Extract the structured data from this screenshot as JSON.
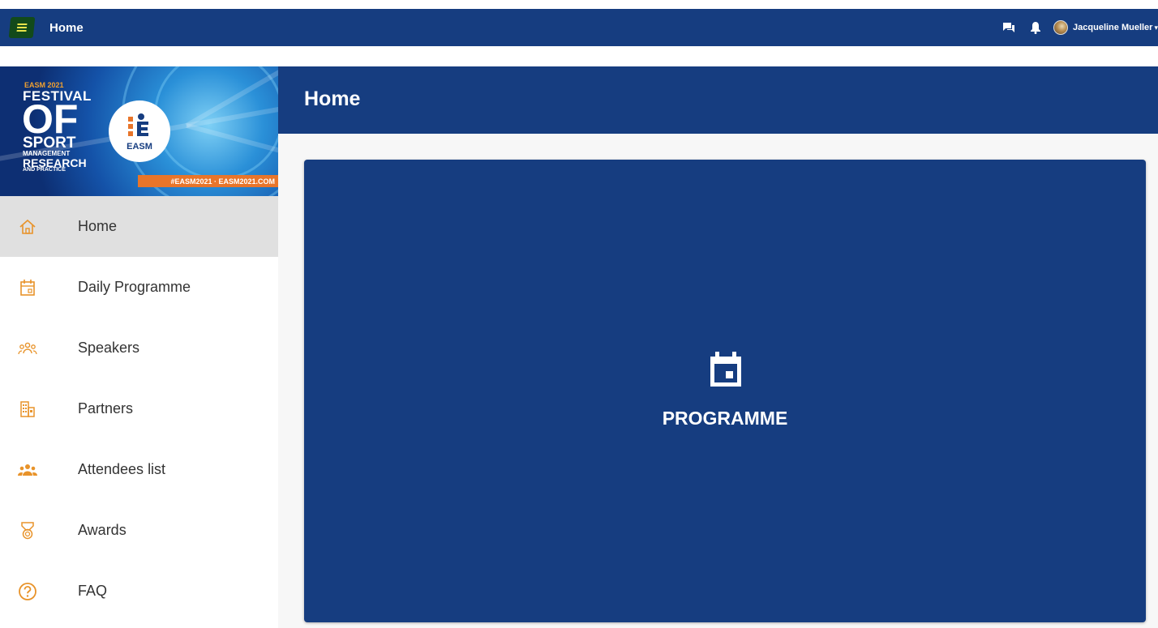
{
  "topbar": {
    "title": "Home",
    "user_name": "Jacqueline Mueller",
    "icons": [
      "menu-icon",
      "chat-icon",
      "bell-icon",
      "avatar",
      "chevron-down-icon"
    ]
  },
  "banner": {
    "line_small": "EASM 2021",
    "line_festival": "FESTIVAL",
    "line_of": "OF",
    "line_sport": "SPORT",
    "line_management": "MANAGEMENT",
    "line_research": "RESEARCH",
    "line_practice": "AND PRACTICE",
    "logo_text": "EASM",
    "strip_text": "#EASM2021 · EASM2021.COM"
  },
  "sidebar": {
    "items": [
      {
        "label": "Home",
        "icon": "home-icon",
        "active": true
      },
      {
        "label": "Daily Programme",
        "icon": "calendar-icon",
        "active": false
      },
      {
        "label": "Speakers",
        "icon": "speakers-icon",
        "active": false
      },
      {
        "label": "Partners",
        "icon": "building-icon",
        "active": false
      },
      {
        "label": "Attendees list",
        "icon": "group-icon",
        "active": false
      },
      {
        "label": "Awards",
        "icon": "medal-icon",
        "active": false
      },
      {
        "label": "FAQ",
        "icon": "help-icon",
        "active": false
      }
    ]
  },
  "main": {
    "title": "Home",
    "card": {
      "label": "PROGRAMME",
      "icon": "calendar-event-icon"
    }
  },
  "colors": {
    "primary": "#163d80",
    "accent_icon": "#e8932a",
    "active_bg": "#e0e0e0",
    "menu_button": "#124a1a"
  }
}
